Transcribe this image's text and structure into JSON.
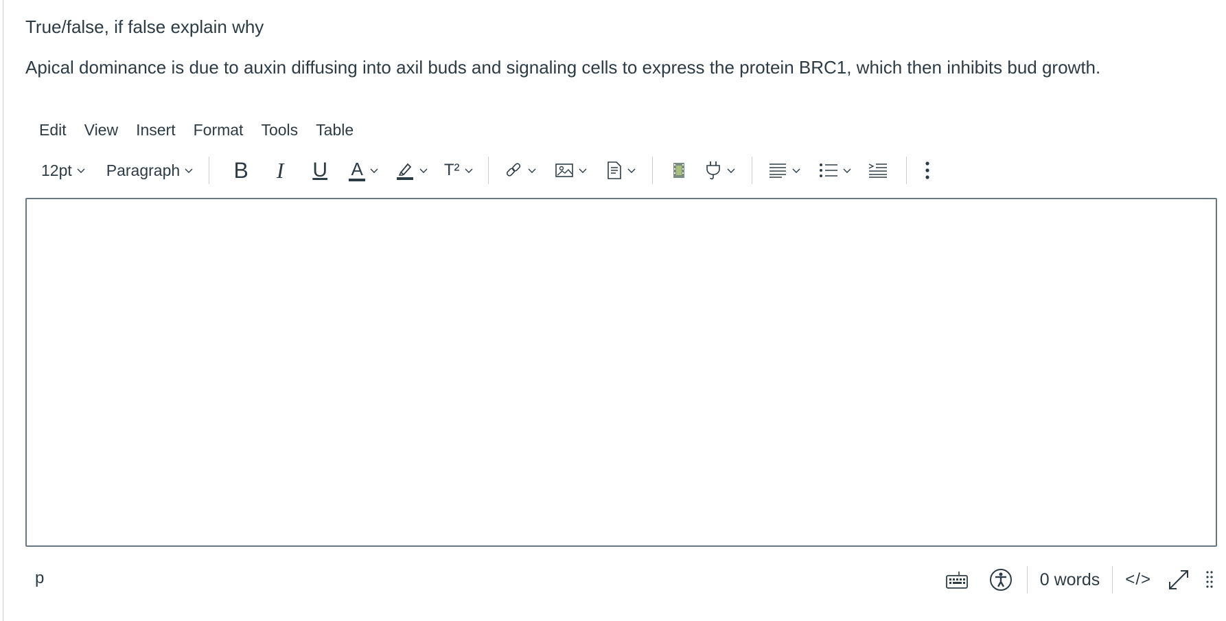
{
  "question": {
    "title": "True/false, if false explain why",
    "text": "Apical dominance is due to auxin diffusing into axil buds and signaling cells to express the protein BRC1, which then inhibits bud growth."
  },
  "menubar": {
    "items": [
      "Edit",
      "View",
      "Insert",
      "Format",
      "Tools",
      "Table"
    ]
  },
  "toolbar": {
    "font_size": "12pt",
    "block_format": "Paragraph",
    "icons": {
      "bold": "B",
      "italic": "I",
      "underline": "U",
      "text_color": "A",
      "superscript": "T²"
    }
  },
  "editor": {
    "content": ""
  },
  "statusbar": {
    "path": "p",
    "word_count": "0 words",
    "html_toggle": "</>"
  },
  "colors": {
    "text": "#2d3b45",
    "border": "#6b7780",
    "separator": "#c7cdd1"
  }
}
